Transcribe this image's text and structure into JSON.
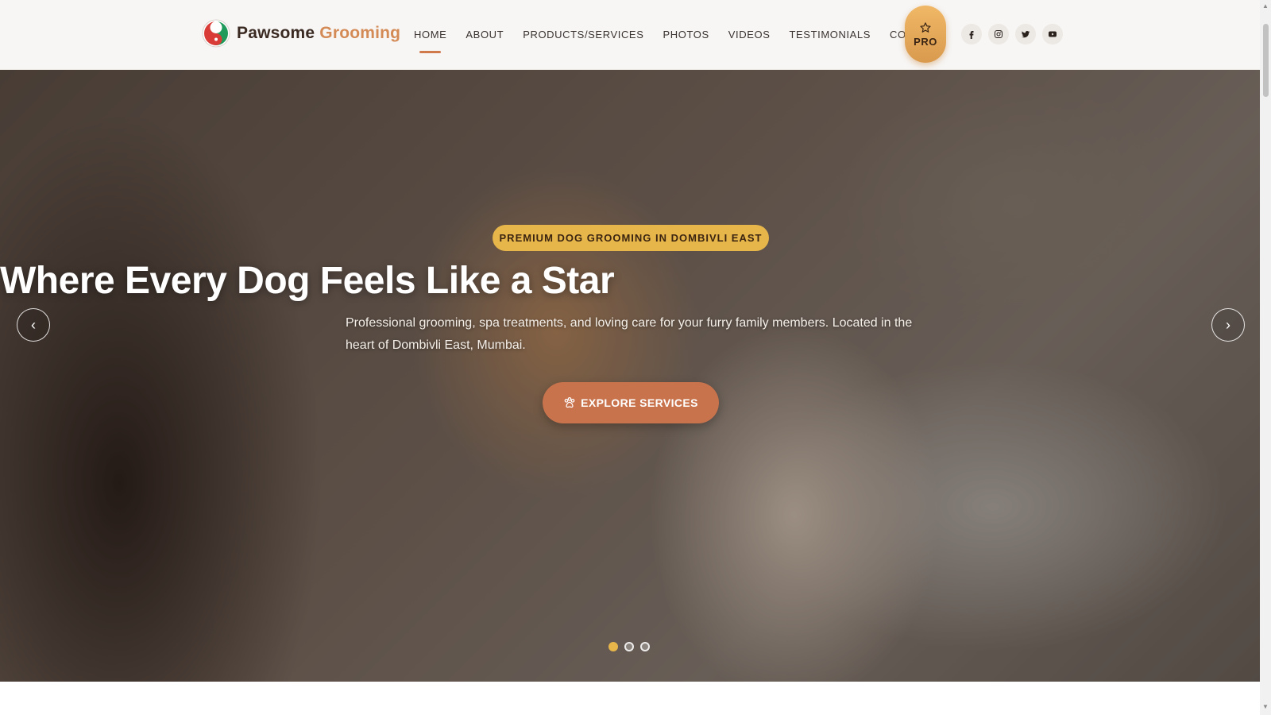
{
  "brand": {
    "name_part1": "Pawsome",
    "name_part2": "Grooming"
  },
  "nav": {
    "items": [
      {
        "label": "HOME",
        "active": true
      },
      {
        "label": "ABOUT",
        "active": false
      },
      {
        "label": "PRODUCTS/SERVICES",
        "active": false
      },
      {
        "label": "PHOTOS",
        "active": false
      },
      {
        "label": "VIDEOS",
        "active": false
      },
      {
        "label": "TESTIMONIALS",
        "active": false
      },
      {
        "label": "CONTACT",
        "active": false
      }
    ]
  },
  "pro_badge": {
    "label": "PRO",
    "icon": "star-icon"
  },
  "socials": [
    "facebook-icon",
    "instagram-icon",
    "twitter-icon",
    "youtube-icon"
  ],
  "hero": {
    "badge": "PREMIUM DOG GROOMING IN DOMBIVLI EAST",
    "title": "Where Every Dog Feels Like a Star",
    "subtitle": "Professional grooming, spa treatments, and loving care for your furry family members. Located in the heart of Dombivli East, Mumbai.",
    "cta_label": "EXPLORE SERVICES",
    "cta_icon": "paw-icon",
    "prev_arrow": "‹",
    "next_arrow": "›",
    "slide_count": 3,
    "active_slide": 1
  },
  "colors": {
    "accent": "#d0794a",
    "badge_gold": "#e6b64b",
    "cta": "#c9734d",
    "brand_dark": "#3a2a22",
    "brand_orange": "#d48a55"
  }
}
